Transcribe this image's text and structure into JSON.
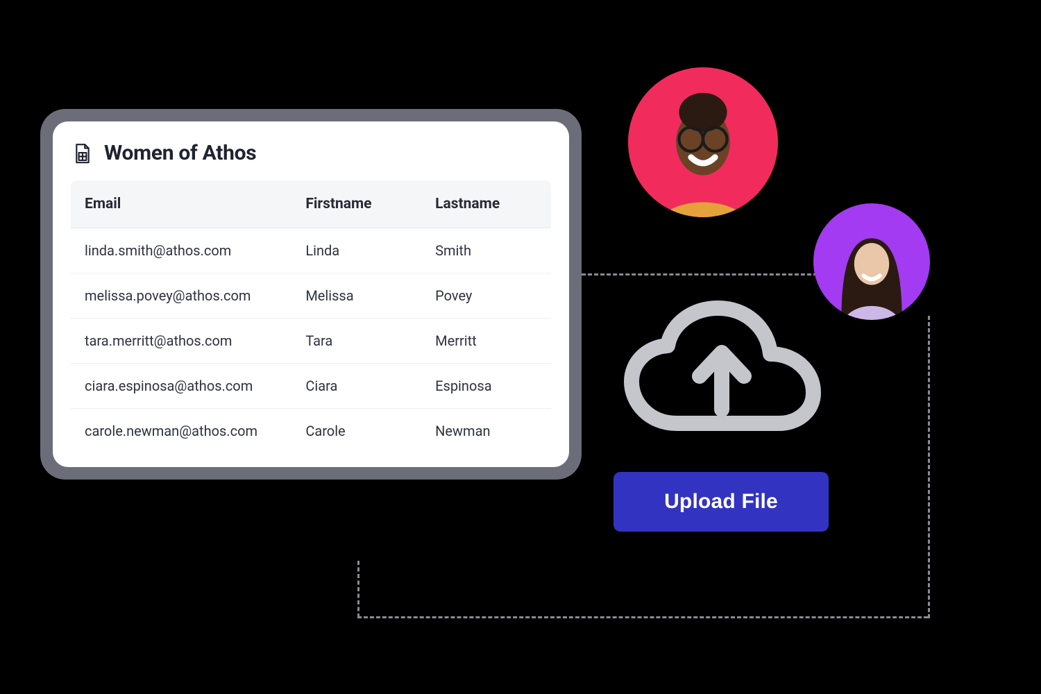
{
  "card": {
    "title": "Women of Athos",
    "columns": [
      "Email",
      "Firstname",
      "Lastname"
    ],
    "rows": [
      {
        "email": "linda.smith@athos.com",
        "first": "Linda",
        "last": "Smith"
      },
      {
        "email": "melissa.povey@athos.com",
        "first": "Melissa",
        "last": "Povey"
      },
      {
        "email": "tara.merritt@athos.com",
        "first": "Tara",
        "last": "Merritt"
      },
      {
        "email": "ciara.espinosa@athos.com",
        "first": "Ciara",
        "last": "Espinosa"
      },
      {
        "email": "carole.newman@athos.com",
        "first": "Carole",
        "last": "Newman"
      }
    ]
  },
  "upload": {
    "button_label": "Upload File"
  },
  "avatars": [
    {
      "name": "avatar-1",
      "bg": "#f22b5d"
    },
    {
      "name": "avatar-2",
      "bg": "#a33bf2"
    }
  ],
  "colors": {
    "button_bg": "#3233c1",
    "card_frame": "#6b6e78",
    "cloud_icon": "#c4c6cc"
  }
}
